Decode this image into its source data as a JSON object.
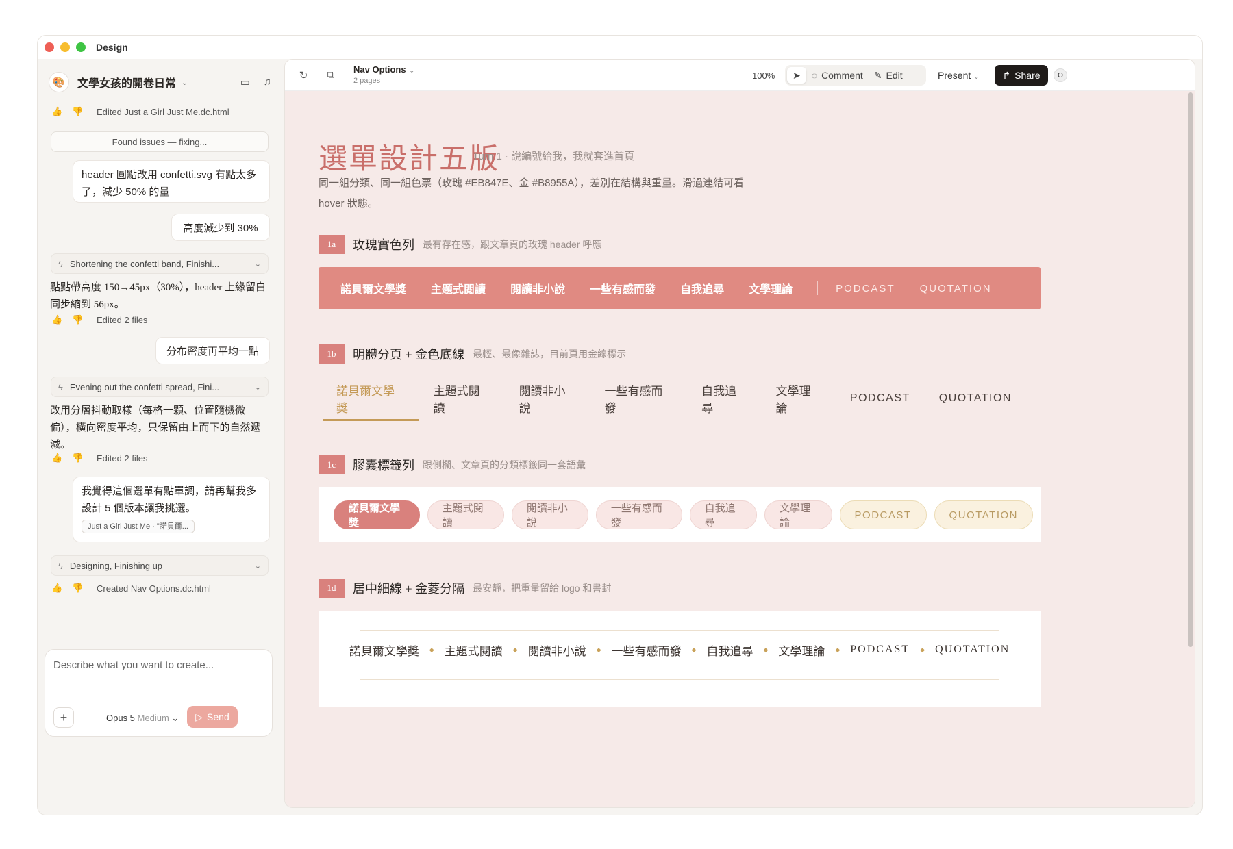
{
  "app": {
    "title": "Design"
  },
  "sidebar": {
    "project_name": "文學女孩的開卷日常",
    "feed": {
      "edited1": "Edited Just a Girl Just Me.dc.html",
      "notice": "Found issues — fixing...",
      "user1": "header 圓點改用 confetti.svg 有點太多了，減少 50% 的量",
      "user2": "高度減少到 30%",
      "status1": "Shortening the confetti band, Finishi...",
      "ai1": "點點帶高度 150→45px（30%），header 上緣留白同步縮到 56px。",
      "edited2": "Edited 2 files",
      "user3": "分布密度再平均一點",
      "status2": "Evening out the confetti spread, Fini...",
      "ai2": "改用分層抖動取樣（每格一顆、位置隨機微偏），橫向密度平均，只保留由上而下的自然遞減。",
      "edited3": "Edited 2 files",
      "user4": "我覺得這個選單有點單調，請再幫我多設計 5 個版本讓我挑選。",
      "user4_chip": "Just a Girl Just Me · \"諾貝爾...",
      "status3": "Designing, Finishing up",
      "created": "Created Nav Options.dc.html"
    },
    "composer": {
      "placeholder": "Describe what you want to create...",
      "model": "Opus 5",
      "level": "Medium",
      "send": "Send"
    }
  },
  "toolbar": {
    "doc_name": "Nav Options",
    "doc_pages": "2 pages",
    "zoom": "100%",
    "comment": "Comment",
    "edit": "Edit",
    "present": "Present",
    "share": "Share",
    "avatar": "O"
  },
  "canvas": {
    "title": "選單設計五版",
    "subtitle": "Turn 1 · 說編號給我，我就套進首頁",
    "intro": "同一組分類、同一組色票（玫瑰 #EB847E、金 #B8955A），差別在結構與重量。滑過連結可看 hover 狀態。",
    "nav_items": [
      "諾貝爾文學獎",
      "主題式閱讀",
      "閱讀非小說",
      "一些有感而發",
      "自我追尋",
      "文學理論"
    ],
    "nav_en": [
      "PODCAST",
      "QUOTATION"
    ],
    "sections": [
      {
        "tag": "1a",
        "title": "玫瑰實色列",
        "desc": "最有存在感，跟文章頁的玫瑰 header 呼應"
      },
      {
        "tag": "1b",
        "title": "明體分頁 + 金色底線",
        "desc": "最輕、最像雜誌，目前頁用金線標示"
      },
      {
        "tag": "1c",
        "title": "膠囊標籤列",
        "desc": "跟側欄、文章頁的分類標籤同一套語彙"
      },
      {
        "tag": "1d",
        "title": "居中細線 + 金菱分隔",
        "desc": "最安靜，把重量留給 logo 和書封"
      }
    ],
    "colors": {
      "rose": "#EB847E",
      "gold": "#B8955A"
    }
  }
}
